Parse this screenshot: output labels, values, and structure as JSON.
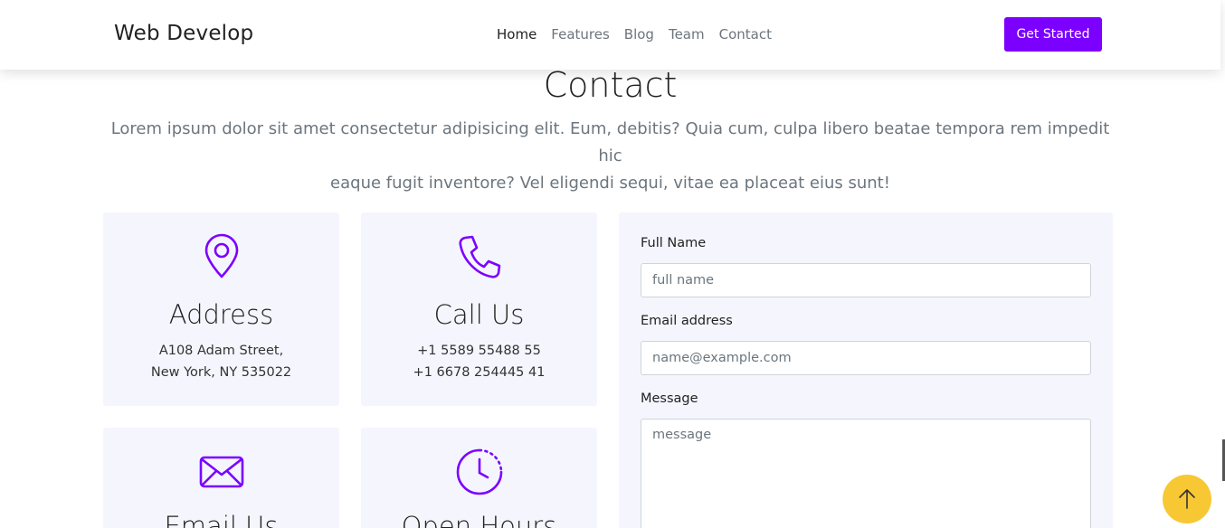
{
  "nav": {
    "brand": "Web Develop",
    "links": [
      "Home",
      "Features",
      "Blog",
      "Team",
      "Contact"
    ],
    "active_index": 0,
    "cta": "Get Started"
  },
  "section": {
    "title": "Contact",
    "description_line1": "Lorem ipsum dolor sit amet consectetur adipisicing elit. Eum, debitis? Quia cum, culpa libero beatae tempora rem impedit hic",
    "description_line2": "eaque fugit inventore? Vel eligendi sequi, vitae ea placeat eius sunt!"
  },
  "cards": [
    {
      "icon": "map-pin-icon",
      "title": "Address",
      "line1": "A108 Adam Street,",
      "line2": "New York, NY 535022"
    },
    {
      "icon": "phone-icon",
      "title": "Call Us",
      "line1": "+1 5589 55488 55",
      "line2": "+1 6678 254445 41"
    },
    {
      "icon": "envelope-icon",
      "title": "Email Us"
    },
    {
      "icon": "clock-icon",
      "title": "Open Hours"
    }
  ],
  "form": {
    "name_label": "Full Name",
    "name_placeholder": "full name",
    "email_label": "Email address",
    "email_placeholder": "name@example.com",
    "message_label": "Message",
    "message_placeholder": "message"
  },
  "colors": {
    "accent": "#7c00ff",
    "card_bg": "#f5f6fd",
    "scroll_button": "#f7c833"
  },
  "scroll_top_icon": "arrow-up-icon"
}
